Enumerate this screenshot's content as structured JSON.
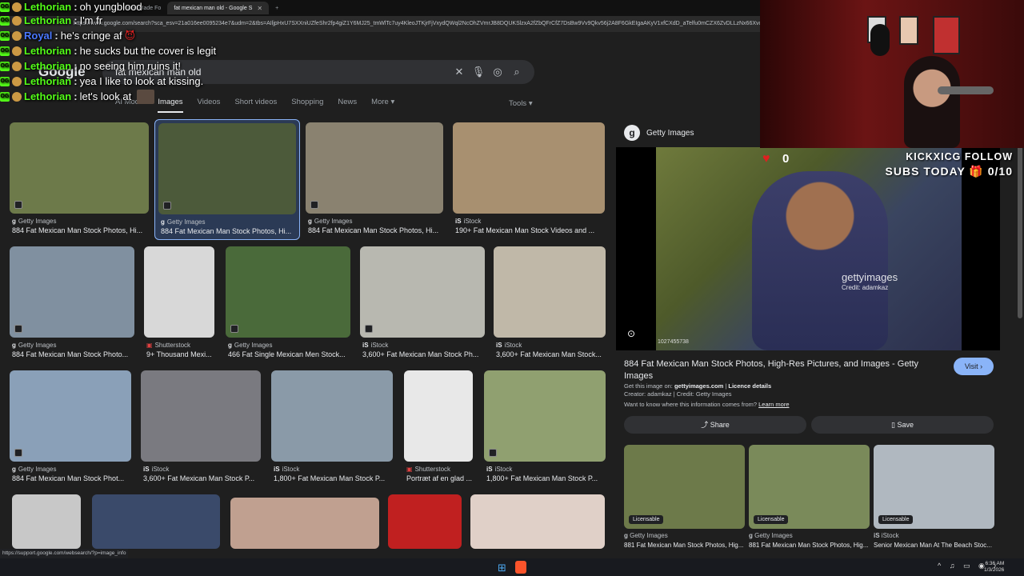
{
  "browser": {
    "tabs": [
      {
        "label": "Was Made Fo",
        "active": false
      },
      {
        "label": "fat mexican man old - Google S",
        "active": true
      }
    ],
    "new_tab": "+",
    "url": "https://www.google.com/search?sca_esv=21a016ee0095234e7&udm=2&tbs=AIljpHxU7SXXniUZfeShr2fp4giZ1Y6MJ25_tmWlTc7uy4KleoJTKjrFjVxydQWql2NcOhZVmrJB8DQUKSlzxA2fZbQFrCfZ7DsBw9Vv9Qkv56j2A8F6GkEIgaAKyV1xfCXdD_aTelfu0mCZX6ZvDLLzNx66XvcdcCgE0_NM"
  },
  "google": {
    "logo": "Google",
    "query": "fat mexican man old",
    "nav_tabs": [
      "AI Mode",
      "Images",
      "Videos",
      "Short videos",
      "Shopping",
      "News",
      "More"
    ],
    "active_tab": "Images",
    "tools": "Tools"
  },
  "results": [
    {
      "source": "Getty Images",
      "logo": "g",
      "caption": "884 Fat Mexican Man Stock Photos, Hi...",
      "color": "#6d7a4a"
    },
    {
      "source": "Getty Images",
      "logo": "g",
      "caption": "884 Fat Mexican Man Stock Photos, Hi...",
      "color": "#4c5a3a"
    },
    {
      "source": "Getty Images",
      "logo": "g",
      "caption": "884 Fat Mexican Man Stock Photos, Hi...",
      "color": "#8a8270"
    },
    {
      "source": "iStock",
      "logo": "iS",
      "caption": "190+ Fat Mexican Man Stock Videos and ...",
      "color": "#a89070"
    },
    {
      "source": "Getty Images",
      "logo": "g",
      "caption": "884 Fat Mexican Man Stock Photo...",
      "color": "#8090a0"
    },
    {
      "source": "Shutterstock",
      "logo": "▣",
      "caption": "9+ Thousand Mexi...",
      "color": "#d8d8d8"
    },
    {
      "source": "Getty Images",
      "logo": "g",
      "caption": "466 Fat Single Mexican Men Stock...",
      "color": "#4a6a3a"
    },
    {
      "source": "iStock",
      "logo": "iS",
      "caption": "3,600+ Fat Mexican Man Stock Ph...",
      "color": "#b8b8b0"
    },
    {
      "source": "iStock",
      "logo": "iS",
      "caption": "3,600+ Fat Mexican Man Stock...",
      "color": "#c0b8a8"
    },
    {
      "source": "Getty Images",
      "logo": "g",
      "caption": "884 Fat Mexican Man Stock Phot...",
      "color": "#8aa0b8"
    },
    {
      "source": "iStock",
      "logo": "iS",
      "caption": "3,600+ Fat Mexican Man Stock P...",
      "color": "#7a7a80"
    },
    {
      "source": "iStock",
      "logo": "iS",
      "caption": "1,800+ Fat Mexican Man Stock P...",
      "color": "#8a9aa8"
    },
    {
      "source": "Shutterstock",
      "logo": "▣",
      "caption": "Portræt af en glad ...",
      "color": "#e8e8e8"
    },
    {
      "source": "iStock",
      "logo": "iS",
      "caption": "1,800+ Fat Mexican Man Stock P...",
      "color": "#90a070"
    },
    {
      "source": "",
      "logo": "",
      "caption": "",
      "color": "#c8c8c8"
    },
    {
      "source": "",
      "logo": "",
      "caption": "",
      "color": "#3a4a6a"
    },
    {
      "source": "",
      "logo": "",
      "caption": "",
      "color": "#c0a090"
    },
    {
      "source": "",
      "logo": "",
      "caption": "",
      "color": "#c02020"
    },
    {
      "source": "",
      "logo": "",
      "caption": "",
      "color": "#e0d0c8"
    }
  ],
  "panel": {
    "site": "Getty Images",
    "watermark": "gettyimages",
    "credit_overlay": "Credit: adamkaz",
    "image_id": "1027455738",
    "title": "884 Fat Mexican Man Stock Photos, High-Res Pictures, and Images - Getty Images",
    "visit": "Visit",
    "get_this": "Get this image on:",
    "domain": "gettyimages.com",
    "licence": "Licence details",
    "creator_line": "Creator: adamkaz | Credit: Getty Images",
    "want_to_know": "Want to know where this information comes from?",
    "learn_more": "Learn more",
    "share": "Share",
    "save": "Save",
    "related": [
      {
        "badge": "Licensable",
        "source": "Getty Images",
        "logo": "g",
        "caption": "881 Fat Mexican Man Stock Photos, Hig...",
        "color": "#6d7a4a"
      },
      {
        "badge": "Licensable",
        "source": "Getty Images",
        "logo": "g",
        "caption": "881 Fat Mexican Man Stock Photos, Hig...",
        "color": "#7a8a5a"
      },
      {
        "badge": "Licensable",
        "source": "iStock",
        "logo": "iS",
        "caption": "Senior Mexican Man At The Beach Stoc...",
        "color": "#b0b8c0"
      }
    ]
  },
  "chat": [
    {
      "user": "Lethorian",
      "msg": "oh yungblood",
      "color": "#53fc18"
    },
    {
      "user": "Lethorian",
      "msg": "I'm fr",
      "color": "#53fc18"
    },
    {
      "user": "Royal",
      "msg": "he's cringe af",
      "color": "#4a78ff"
    },
    {
      "user": "Lethorian",
      "msg": "he sucks but the cover is legit",
      "color": "#53fc18"
    },
    {
      "user": "Lethorian",
      "msg": "no seeing him ruins it!",
      "color": "#53fc18"
    },
    {
      "user": "Lethorian",
      "msg": "yea I like to look at kissing.",
      "color": "#53fc18"
    },
    {
      "user": "Lethorian",
      "msg": "let's look at",
      "color": "#53fc18"
    }
  ],
  "hud": {
    "hearts": "0",
    "follow": "KICKXICG FOLLOW",
    "subs": "SUBS TODAY 🎁 0/10"
  },
  "status_bar": "https://support.google.com/websearch/?p=image_info",
  "taskbar": {
    "time": "6:36 AM",
    "date": "1/3/2026"
  }
}
